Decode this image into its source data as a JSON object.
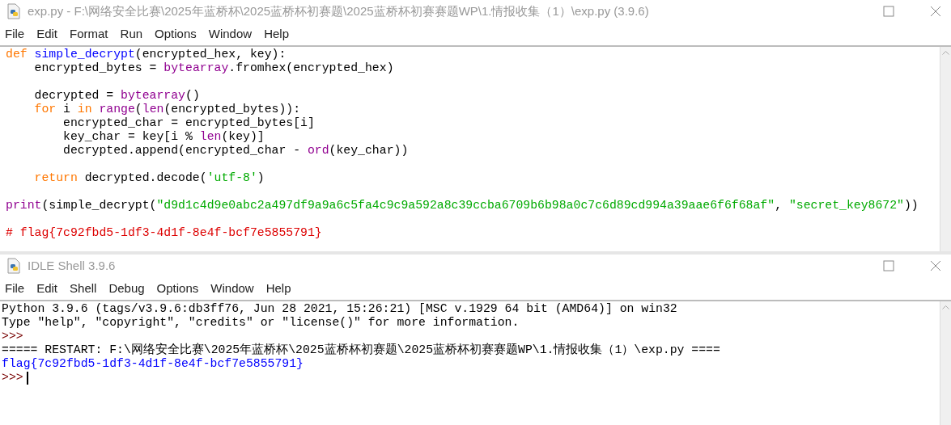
{
  "editor": {
    "title": "exp.py - F:\\网络安全比赛\\2025年蓝桥杯\\2025蓝桥杯初赛题\\2025蓝桥杯初赛赛题WP\\1.情报收集（1）\\exp.py (3.9.6)",
    "menu": [
      "File",
      "Edit",
      "Format",
      "Run",
      "Options",
      "Window",
      "Help"
    ],
    "lines": [
      {
        "kind": "code",
        "tokens": [
          {
            "kind": "keyword",
            "text": "def"
          },
          {
            "kind": "definition",
            "text": " simple_decrypt"
          },
          {
            "kind": "plain",
            "text": "(encrypted_hex, key):"
          }
        ]
      },
      {
        "kind": "code",
        "tokens": [
          {
            "kind": "plain",
            "text": "    encrypted_bytes = "
          },
          {
            "kind": "builtin",
            "text": "bytearray"
          },
          {
            "kind": "plain",
            "text": ".fromhex(encrypted_hex)"
          }
        ]
      },
      {
        "kind": "blank"
      },
      {
        "kind": "code",
        "tokens": [
          {
            "kind": "plain",
            "text": "    decrypted = "
          },
          {
            "kind": "builtin",
            "text": "bytearray"
          },
          {
            "kind": "plain",
            "text": "()"
          }
        ]
      },
      {
        "kind": "code",
        "tokens": [
          {
            "kind": "keyword",
            "text": "    for"
          },
          {
            "kind": "plain",
            "text": " i "
          },
          {
            "kind": "keyword",
            "text": "in"
          },
          {
            "kind": "builtin",
            "text": " range"
          },
          {
            "kind": "plain",
            "text": "("
          },
          {
            "kind": "builtin",
            "text": "len"
          },
          {
            "kind": "plain",
            "text": "(encrypted_bytes)):"
          }
        ]
      },
      {
        "kind": "code",
        "tokens": [
          {
            "kind": "plain",
            "text": "        encrypted_char = encrypted_bytes[i]"
          }
        ]
      },
      {
        "kind": "code",
        "tokens": [
          {
            "kind": "plain",
            "text": "        key_char = key[i % "
          },
          {
            "kind": "builtin",
            "text": "len"
          },
          {
            "kind": "plain",
            "text": "(key)]"
          }
        ]
      },
      {
        "kind": "code",
        "tokens": [
          {
            "kind": "plain",
            "text": "        decrypted.append(encrypted_char - "
          },
          {
            "kind": "builtin",
            "text": "ord"
          },
          {
            "kind": "plain",
            "text": "(key_char))"
          }
        ]
      },
      {
        "kind": "blank"
      },
      {
        "kind": "code",
        "tokens": [
          {
            "kind": "keyword",
            "text": "    return"
          },
          {
            "kind": "plain",
            "text": " decrypted.decode("
          },
          {
            "kind": "string",
            "text": "'utf-8'"
          },
          {
            "kind": "plain",
            "text": ")"
          }
        ]
      },
      {
        "kind": "blank"
      },
      {
        "kind": "code",
        "tokens": [
          {
            "kind": "builtin",
            "text": "print"
          },
          {
            "kind": "plain",
            "text": "(simple_decrypt("
          },
          {
            "kind": "string",
            "text": "\"d9d1c4d9e0abc2a497df9a9a6c5fa4c9c9a592a8c39ccba6709b6b98a0c7c6d89cd994a39aae6f6f68af\""
          },
          {
            "kind": "plain",
            "text": ", "
          },
          {
            "kind": "string",
            "text": "\"secret_key8672\""
          },
          {
            "kind": "plain",
            "text": "))"
          }
        ]
      },
      {
        "kind": "blank"
      },
      {
        "kind": "code",
        "tokens": [
          {
            "kind": "comment",
            "text": "# flag{7c92fbd5-1df3-4d1f-8e4f-bcf7e5855791}"
          }
        ]
      }
    ]
  },
  "shell": {
    "title": "IDLE Shell 3.9.6",
    "menu": [
      "File",
      "Edit",
      "Shell",
      "Debug",
      "Options",
      "Window",
      "Help"
    ],
    "lines": [
      {
        "kind": "output",
        "text": "Python 3.9.6 (tags/v3.9.6:db3ff76, Jun 28 2021, 15:26:21) [MSC v.1929 64 bit (AMD64)] on win32"
      },
      {
        "kind": "output",
        "text": "Type \"help\", \"copyright\", \"credits\" or \"license()\" for more information."
      },
      {
        "kind": "prompt",
        "text": ">>>"
      },
      {
        "kind": "output",
        "text": "===== RESTART: F:\\网络安全比赛\\2025年蓝桥杯\\2025蓝桥杯初赛题\\2025蓝桥杯初赛赛题WP\\1.情报收集（1）\\exp.py ===="
      },
      {
        "kind": "stdout",
        "text": "flag{7c92fbd5-1df3-4d1f-8e4f-bcf7e5855791}"
      },
      {
        "kind": "input_prompt",
        "text": ">>>"
      }
    ]
  }
}
